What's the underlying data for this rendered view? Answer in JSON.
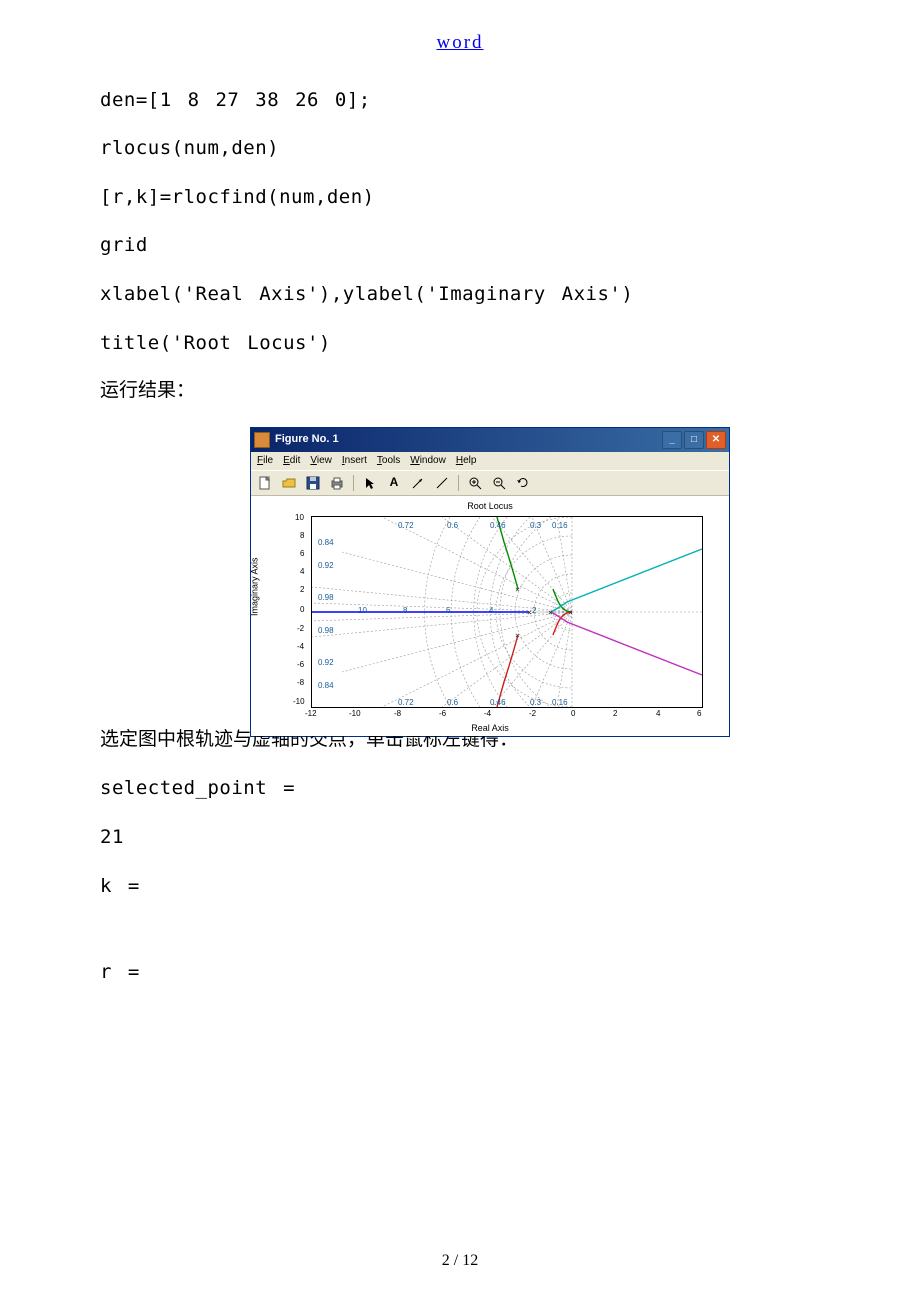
{
  "header": {
    "link_text": "word"
  },
  "code": {
    "line1": "den=[1 8 27 38 26 0];",
    "line2": "rlocus(num,den)",
    "line3": "[r,k]=rlocfind(num,den)",
    "line4": "grid",
    "line5": "xlabel('Real Axis'),ylabel('Imaginary Axis')",
    "line6": "title('Root Locus')"
  },
  "text": {
    "run_result": "运行结果：",
    "below_fig": "选定图中根轨迹与虚轴的交点，单击鼠标左键得：",
    "sel_point": "selected_point =",
    "val21": "21",
    "k_eq": "k =",
    "r_eq": "r ="
  },
  "figure_window": {
    "title": "Figure No. 1",
    "menus": {
      "file": "File",
      "edit": "Edit",
      "view": "View",
      "insert": "Insert",
      "tools": "Tools",
      "window": "Window",
      "help": "Help"
    },
    "plot_title": "Root Locus",
    "xlabel": "Real Axis",
    "ylabel": "Imaginary Axis",
    "yticks": [
      "-10",
      "-8",
      "-6",
      "-4",
      "-2",
      "0",
      "2",
      "4",
      "6",
      "8",
      "10"
    ],
    "xticks": [
      "-12",
      "-10",
      "-8",
      "-6",
      "-4",
      "-2",
      "0",
      "2",
      "4",
      "6"
    ],
    "damping_labels": [
      "0.72",
      "0.6",
      "0.46",
      "0.3",
      "0.16",
      "0.84",
      "0.92",
      "0.98",
      "0.98",
      "0.92",
      "0.84",
      "0.72",
      "0.6",
      "0.46",
      "0.3",
      "0.16"
    ],
    "radial_labels": [
      "10",
      "8",
      "6",
      "4",
      "2"
    ]
  },
  "footer": {
    "page_info": "2 / 12"
  },
  "chart_data": {
    "type": "line",
    "title": "Root Locus",
    "xlabel": "Real Axis",
    "ylabel": "Imaginary Axis",
    "xlim": [
      -12,
      6
    ],
    "ylim": [
      -10,
      10
    ],
    "grid": true,
    "damping_ratios": [
      0.16,
      0.3,
      0.46,
      0.6,
      0.72,
      0.84,
      0.92,
      0.98
    ],
    "natural_frequencies": [
      2,
      4,
      6,
      8,
      10
    ],
    "open_loop_poles": [
      {
        "re": 0,
        "im": 0
      },
      {
        "re": -1,
        "im": 0
      },
      {
        "re": -2,
        "im": 0
      },
      {
        "re": -2.5,
        "im": 2.5
      },
      {
        "re": -2.5,
        "im": -2.5
      }
    ],
    "series": [
      {
        "name": "branch-real-left",
        "color": "#0000ff",
        "points": [
          {
            "x": -2,
            "y": 0
          },
          {
            "x": -12,
            "y": 0
          }
        ]
      },
      {
        "name": "branch-cyan",
        "color": "#00cccc",
        "points": [
          {
            "x": -1,
            "y": 1
          },
          {
            "x": 6,
            "y": 5
          }
        ]
      },
      {
        "name": "branch-magenta",
        "color": "#cc33cc",
        "points": [
          {
            "x": -1,
            "y": -1
          },
          {
            "x": 6,
            "y": -5
          }
        ]
      },
      {
        "name": "branch-green",
        "color": "#00aa00",
        "points": [
          {
            "x": -2.5,
            "y": 2.5
          },
          {
            "x": -4,
            "y": 10
          }
        ]
      },
      {
        "name": "branch-red",
        "color": "#dd0000",
        "points": [
          {
            "x": -2.5,
            "y": -2.5
          },
          {
            "x": -4,
            "y": -10
          }
        ]
      }
    ]
  }
}
